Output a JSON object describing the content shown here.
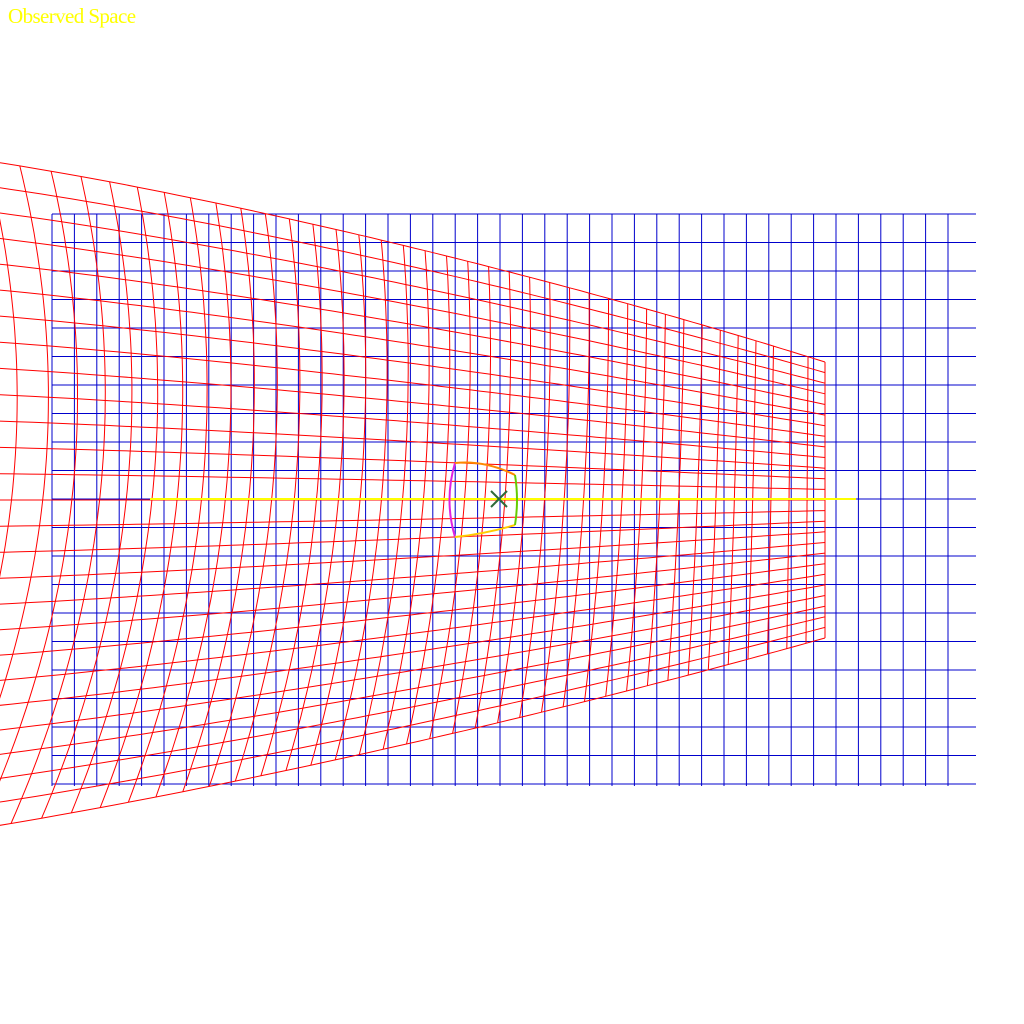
{
  "title": "Observed Space",
  "colors": {
    "background": "#ffffff",
    "title": "#ffff00",
    "reference_grid": "#0000cc",
    "observed_grid": "#ff0000",
    "axis_line": "#ffff00",
    "marker": "#2f6a3a",
    "shape_left": "#e020e0",
    "shape_right_top": "#ff8800",
    "shape_right_bottom": "#ffcc00",
    "shape_right_edge": "#66cc00"
  },
  "marker_icon": "x-marker-icon"
}
